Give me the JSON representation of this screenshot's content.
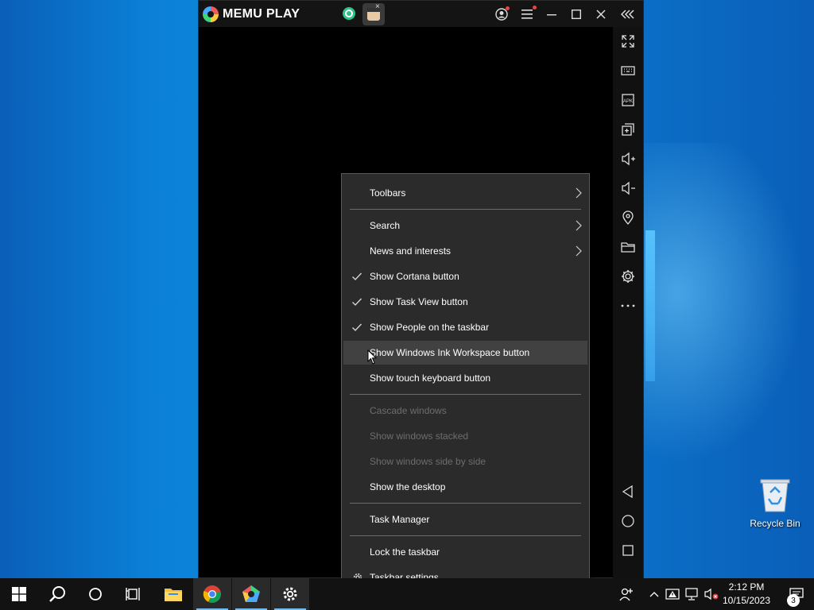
{
  "memu": {
    "logo_text": "MEMU PLAY",
    "tab_close": "×"
  },
  "context_menu": {
    "items": [
      {
        "label": "Toolbars"
      },
      {
        "label": "Search"
      },
      {
        "label": "News and interests"
      },
      {
        "label": "Show Cortana button",
        "checked": true
      },
      {
        "label": "Show Task View button",
        "checked": true
      },
      {
        "label": "Show People on the taskbar",
        "checked": true
      },
      {
        "label": "Show Windows Ink Workspace button"
      },
      {
        "label": "Show touch keyboard button"
      },
      {
        "label": "Cascade windows",
        "disabled": true
      },
      {
        "label": "Show windows stacked",
        "disabled": true
      },
      {
        "label": "Show windows side by side",
        "disabled": true
      },
      {
        "label": "Show the desktop"
      },
      {
        "label": "Task Manager"
      },
      {
        "label": "Lock the taskbar"
      },
      {
        "label": "Taskbar settings"
      }
    ]
  },
  "desktop": {
    "recycle_bin_label": "Recycle Bin"
  },
  "taskbar": {
    "clock_time": "2:12 PM",
    "clock_date": "10/15/2023",
    "notification_count": "3",
    "accent_color": "#76b9ed"
  }
}
